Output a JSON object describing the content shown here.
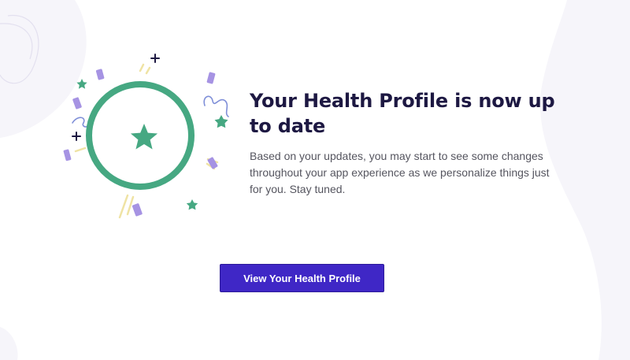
{
  "main": {
    "title": "Your Health Profile is now up to date",
    "description": "Based on your updates, you may start to see some changes throughout your app experience as we personalize things just for you. Stay tuned.",
    "cta_label": "View Your Health Profile"
  },
  "illustration": {
    "icon": "celebration-ring-star-icon",
    "ring_color": "#46a882",
    "star_color": "#46a882",
    "confetti_color": "#a693e3",
    "plus_color": "#1d1842",
    "ray_color": "#efe3a4"
  },
  "colors": {
    "title": "#1d1842",
    "text": "#55555f",
    "button": "#3f27c6",
    "background_shape": "#f5f4fa"
  }
}
